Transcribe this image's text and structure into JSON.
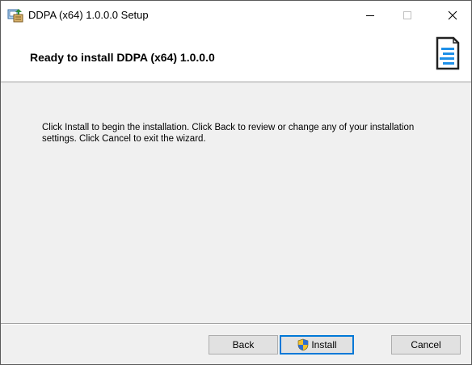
{
  "window": {
    "title": "DDPA (x64) 1.0.0.0 Setup",
    "controls": [
      "minimize",
      "maximize",
      "close"
    ]
  },
  "banner": {
    "heading": "Ready to install DDPA (x64) 1.0.0.0",
    "logo_icon": "installer-logo-icon"
  },
  "body": {
    "text": "Click Install to begin the installation. Click Back to review or change any of your installation settings. Click Cancel to exit the wizard."
  },
  "footer": {
    "back_label": "Back",
    "install_label": "Install",
    "cancel_label": "Cancel"
  },
  "colors": {
    "accent": "#0078d7",
    "button_bg": "#e1e1e1",
    "panel_bg": "#f0f0f0"
  }
}
